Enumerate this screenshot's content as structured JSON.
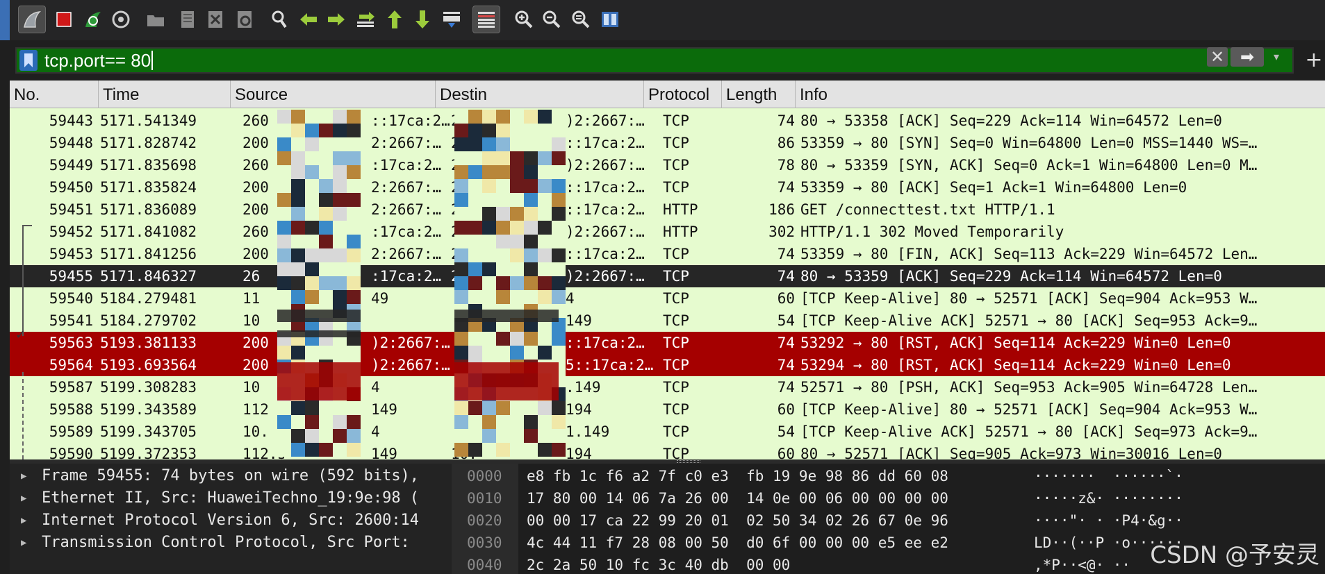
{
  "toolbar": {
    "buttons": [
      {
        "icon": "shark-fin-start-icon"
      },
      {
        "icon": "stop-icon"
      },
      {
        "icon": "restart-icon"
      },
      {
        "icon": "capture-options-icon"
      },
      {
        "icon": "open-file-icon"
      },
      {
        "icon": "save-file-icon"
      },
      {
        "icon": "close-file-icon"
      },
      {
        "icon": "reload-icon"
      },
      {
        "icon": "find-icon"
      },
      {
        "icon": "go-back-icon"
      },
      {
        "icon": "go-forward-icon"
      },
      {
        "icon": "go-to-packet-icon"
      },
      {
        "icon": "first-packet-icon"
      },
      {
        "icon": "last-packet-icon"
      },
      {
        "icon": "auto-scroll-icon"
      },
      {
        "icon": "colorize-icon"
      },
      {
        "icon": "zoom-in-icon"
      },
      {
        "icon": "zoom-out-icon"
      },
      {
        "icon": "normal-size-icon"
      },
      {
        "icon": "resize-columns-icon"
      }
    ]
  },
  "filter": {
    "value": "tcp.port== 80",
    "valid_color": "#0b6b0b",
    "clear_label": "✕",
    "apply_label": "➡",
    "dropdown_label": "▾",
    "add_label": "+"
  },
  "packet_list": {
    "columns": [
      "No.",
      "Time",
      "Source",
      "Destin",
      "Protocol",
      "Length",
      "Info"
    ],
    "rows": [
      {
        "no": "59443",
        "time": "5171.541349",
        "src": "260",
        "dst": "200",
        "src2": "::17ca:2…",
        "dst2": ")2:2667:…",
        "proto": "TCP",
        "len": "74",
        "info": "80 → 53358 [ACK] Seq=229 Ack=114 Win=64572 Len=0",
        "style": "normal"
      },
      {
        "no": "59448",
        "time": "5171.828742",
        "src": "200",
        "dst": "260",
        "src2": "2:2667:…",
        "dst2": "::17ca:2…",
        "proto": "TCP",
        "len": "86",
        "info": "53359 → 80 [SYN] Seq=0 Win=64800 Len=0 MSS=1440 WS=…",
        "style": "normal"
      },
      {
        "no": "59449",
        "time": "5171.835698",
        "src": "260",
        "dst": "20",
        "src2": ":17ca:2…",
        "dst2": ")2:2667:…",
        "proto": "TCP",
        "len": "78",
        "info": "80 → 53359 [SYN, ACK] Seq=0 Ack=1 Win=64800 Len=0 M…",
        "style": "normal"
      },
      {
        "no": "59450",
        "time": "5171.835824",
        "src": "200",
        "dst": "26",
        "src2": "2:2667:…",
        "dst2": "::17ca:2…",
        "proto": "TCP",
        "len": "74",
        "info": "53359 → 80 [ACK] Seq=1 Ack=1 Win=64800 Len=0",
        "style": "normal"
      },
      {
        "no": "59451",
        "time": "5171.836089",
        "src": "200",
        "dst": "2",
        "src2": "2:2667:…",
        "dst2": "::17ca:2…",
        "proto": "HTTP",
        "len": "186",
        "info": "GET /connecttest.txt HTTP/1.1",
        "style": "normal"
      },
      {
        "no": "59452",
        "time": "5171.841082",
        "src": "260",
        "dst": "2",
        "src2": ":17ca:2…",
        "dst2": ")2:2667:…",
        "proto": "HTTP",
        "len": "302",
        "info": "HTTP/1.1 302 Moved Temporarily",
        "style": "normal"
      },
      {
        "no": "59453",
        "time": "5171.841256",
        "src": "200",
        "dst": "2",
        "src2": "2:2667:…",
        "dst2": "::17ca:2…",
        "proto": "TCP",
        "len": "74",
        "info": "53359 → 80 [FIN, ACK] Seq=113 Ack=229 Win=64572 Len…",
        "style": "normal"
      },
      {
        "no": "59455",
        "time": "5171.846327",
        "src": "26",
        "dst": "2",
        "src2": ":17ca:2…",
        "dst2": ")2:2667:…",
        "proto": "TCP",
        "len": "74",
        "info": "80 → 53359 [ACK] Seq=229 Ack=114 Win=64572 Len=0",
        "style": "sel"
      },
      {
        "no": "59540",
        "time": "5184.279481",
        "src": "11",
        "dst": "",
        "src2": "49",
        "dst2": "4",
        "proto": "TCP",
        "len": "60",
        "info": "[TCP Keep-Alive] 80 → 52571 [ACK] Seq=904 Ack=953 W…",
        "style": "normal"
      },
      {
        "no": "59541",
        "time": "5184.279702",
        "src": "10",
        "dst": "",
        "src2": "",
        "dst2": "149",
        "proto": "TCP",
        "len": "54",
        "info": "[TCP Keep-Alive ACK] 52571 → 80 [ACK] Seq=953 Ack=9…",
        "style": "normal"
      },
      {
        "no": "59563",
        "time": "5193.381133",
        "src": "200",
        "dst": "",
        "src2": ")2:2667:…",
        "dst2": "::17ca:2…",
        "proto": "TCP",
        "len": "74",
        "info": "53292 → 80 [RST, ACK] Seq=114 Ack=229 Win=0 Len=0",
        "style": "rst"
      },
      {
        "no": "59564",
        "time": "5193.693564",
        "src": "200",
        "dst": "",
        "src2": ")2:2667:…",
        "dst2": "5::17ca:2…",
        "proto": "TCP",
        "len": "74",
        "info": "53294 → 80 [RST, ACK] Seq=114 Ack=229 Win=0 Len=0",
        "style": "rst"
      },
      {
        "no": "59587",
        "time": "5199.308283",
        "src": "10",
        "dst": "",
        "src2": "4",
        "dst2": ".149",
        "proto": "TCP",
        "len": "74",
        "info": "52571 → 80 [PSH, ACK] Seq=953 Ack=905 Win=64728 Len…",
        "style": "normal"
      },
      {
        "no": "59588",
        "time": "5199.343589",
        "src": "112",
        "dst": "",
        "src2": "149",
        "dst2": "194",
        "proto": "TCP",
        "len": "60",
        "info": "[TCP Keep-Alive] 80 → 52571 [ACK] Seq=904 Ack=953 W…",
        "style": "normal"
      },
      {
        "no": "59589",
        "time": "5199.343705",
        "src": "10.",
        "dst": "",
        "src2": "4",
        "dst2": "1.149",
        "proto": "TCP",
        "len": "54",
        "info": "[TCP Keep-Alive ACK] 52571 → 80 [ACK] Seq=973 Ack=9…",
        "style": "normal"
      },
      {
        "no": "59590",
        "time": "5199.372353",
        "src": "112.3",
        "dst": "10.",
        "src2": "149",
        "dst2": "194",
        "proto": "TCP",
        "len": "60",
        "info": "80 → 52571 [ACK] Seq=905 Ack=973 Win=30016 Len=0",
        "style": "normal"
      }
    ]
  },
  "details": {
    "rows": [
      "Frame 59455: 74 bytes on wire (592 bits),",
      "Ethernet II, Src: HuaweiTechno_19:9e:98 (",
      "Internet Protocol Version 6, Src: 2600:14",
      "Transmission Control Protocol, Src Port: "
    ]
  },
  "bytes": {
    "rows": [
      {
        "offset": "0000",
        "hex": "e8 fb 1c f6 a2 7f c0 e3  fb 19 9e 98 86 dd 60 08",
        "ascii": "·······  ······`·"
      },
      {
        "offset": "0010",
        "hex": "17 80 00 14 06 7a 26 00  14 0e 00 06 00 00 00 00",
        "ascii": "·····z&· ········"
      },
      {
        "offset": "0020",
        "hex": "00 00 17 ca 22 99 20 01  02 50 34 02 26 67 0e 96",
        "ascii": "····\"· · ·P4·&g··"
      },
      {
        "offset": "0030",
        "hex": "4c 44 11 f7 28 08 00 50  d0 6f 00 00 00 e5 ee e2",
        "ascii": "LD··(··P ·o······"
      },
      {
        "offset": "0040",
        "hex": "2c 2a 50 10 fc 3c 40 db  00 00",
        "ascii": ",*P··<@· ··"
      }
    ]
  },
  "watermark": "CSDN @予安灵",
  "colors": {
    "list_bg": "#e6fbcf",
    "selected_bg": "#262626",
    "rst_bg": "#a50000",
    "toolbar_bg": "#252526"
  }
}
